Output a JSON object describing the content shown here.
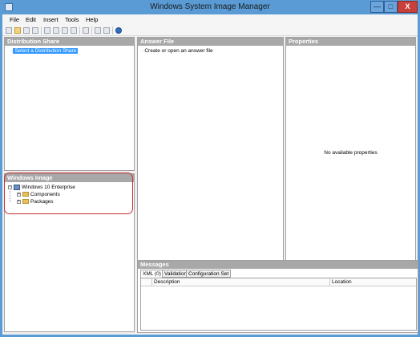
{
  "window": {
    "title": "Windows System Image Manager",
    "min": "—",
    "max": "□",
    "close": "X"
  },
  "menu": [
    "File",
    "Edit",
    "Insert",
    "Tools",
    "Help"
  ],
  "panes": {
    "distribution_share": {
      "header": "Distribution Share",
      "placeholder_item": "Select a Distribution Share"
    },
    "answer_file": {
      "header": "Answer File",
      "placeholder_item": "Create or open an answer file"
    },
    "properties": {
      "header": "Properties",
      "empty_text": "No available properties"
    },
    "windows_image": {
      "header": "Windows Image",
      "root": "Windows 10 Enterprise",
      "children": [
        "Components",
        "Packages"
      ]
    },
    "messages": {
      "header": "Messages",
      "tabs": [
        "XML (0)",
        "Validation",
        "Configuration Set"
      ],
      "columns": [
        "Description",
        "Location"
      ]
    }
  }
}
